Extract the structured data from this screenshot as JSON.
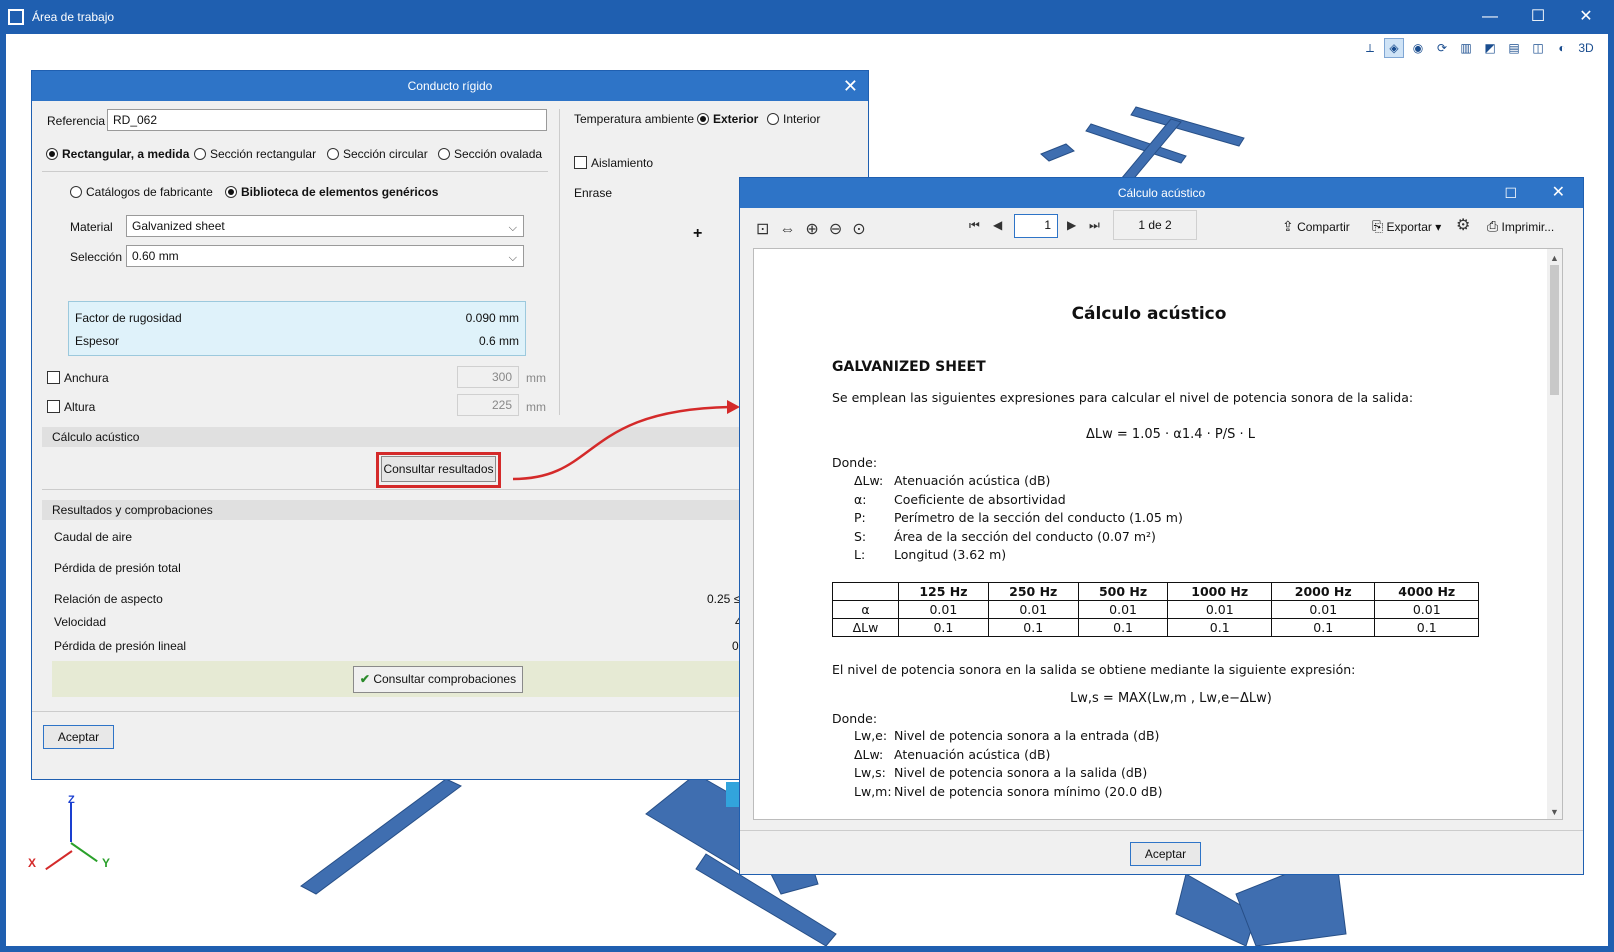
{
  "main_window": {
    "title": "Área de trabajo",
    "minimize": "—",
    "maximize": "☐",
    "close": "✕"
  },
  "view_toolbar": [
    "⟂",
    "◈",
    "◉",
    "⟳",
    "▥",
    "◩",
    "▤",
    "◫",
    "◐",
    "3D"
  ],
  "axes": {
    "x": "X",
    "y": "Y",
    "z": "Z"
  },
  "dialog1": {
    "title": "Conducto rígido",
    "close": "✕",
    "reference_label": "Referencia",
    "reference_value": "RD_062",
    "section_options": [
      "Rectangular, a medida",
      "Sección rectangular",
      "Sección circular",
      "Sección ovalada"
    ],
    "source_options": [
      "Catálogos de fabricante",
      "Biblioteca de elementos genéricos"
    ],
    "material_label": "Material",
    "material_value": "Galvanized sheet",
    "selection_label": "Selección",
    "selection_value": "0.60 mm",
    "info": [
      {
        "label": "Factor de rugosidad",
        "value": "0.090 mm"
      },
      {
        "label": "Espesor",
        "value": "0.6 mm"
      }
    ],
    "width_label": "Anchura",
    "width_value": "300",
    "width_unit": "mm",
    "height_label": "Altura",
    "height_value": "225",
    "height_unit": "mm",
    "temp_label": "Temperatura ambiente",
    "temp_options": [
      "Exterior",
      "Interior"
    ],
    "insulation_label": "Aislamiento",
    "flush_label": "Enrase",
    "acoustic_section": "Cálculo acústico",
    "consult_results": "Consultar resultados",
    "results_section": "Resultados y comprobaciones",
    "results": [
      {
        "label": "Caudal de aire",
        "value": ""
      },
      {
        "label": "Pérdida de presión total",
        "value": ""
      },
      {
        "label": "Relación de aspecto",
        "value": "0.25 ≤"
      },
      {
        "label": "Velocidad",
        "value": "4."
      },
      {
        "label": "Pérdida de presión lineal",
        "value": "0.8"
      }
    ],
    "consult_checks": "Consultar comprobaciones",
    "checkmark": "✔",
    "accept": "Aceptar"
  },
  "dialog2": {
    "title": "Cálculo acústico",
    "maximize": "☐",
    "close": "✕",
    "page_input": "1",
    "page_count": "1 de 2",
    "share": "Compartir",
    "export": "Exportar",
    "print": "Imprimir...",
    "accept": "Aceptar",
    "doc": {
      "title": "Cálculo acústico",
      "material_heading": "GALVANIZED SHEET",
      "intro": "Se emplean las siguientes expresiones para calcular el nivel de potencia sonora de la salida:",
      "formula1": "ΔLw = 1.05 · α1.4 · P/S · L",
      "where": "Donde:",
      "defs1": [
        {
          "sym": "ΔLw:",
          "desc": "Atenuación acústica (dB)"
        },
        {
          "sym": "α:",
          "desc": "Coeficiente de absortividad"
        },
        {
          "sym": "P:",
          "desc": "Perímetro de la sección del conducto (1.05 m)"
        },
        {
          "sym": "S:",
          "desc": "Área de la sección del conducto (0.07 m²)"
        },
        {
          "sym": "L:",
          "desc": "Longitud (3.62 m)"
        }
      ],
      "table_headers": [
        "",
        "125 Hz",
        "250 Hz",
        "500 Hz",
        "1000 Hz",
        "2000 Hz",
        "4000 Hz"
      ],
      "table_rows": [
        [
          "α",
          "0.01",
          "0.01",
          "0.01",
          "0.01",
          "0.01",
          "0.01"
        ],
        [
          "ΔLw",
          "0.1",
          "0.1",
          "0.1",
          "0.1",
          "0.1",
          "0.1"
        ]
      ],
      "intro2": "El nivel de potencia sonora en la salida se obtiene mediante la siguiente expresión:",
      "formula2": "Lw,s = MAX(Lw,m , Lw,e−ΔLw)",
      "defs2": [
        {
          "sym": "Lw,e:",
          "desc": "Nivel de potencia sonora a la entrada (dB)"
        },
        {
          "sym": "ΔLw:",
          "desc": "Atenuación acústica (dB)"
        },
        {
          "sym": "Lw,s:",
          "desc": "Nivel de potencia sonora a la salida (dB)"
        },
        {
          "sym": "Lw,m:",
          "desc": "Nivel de potencia sonora mínimo (20.0 dB)"
        }
      ]
    }
  },
  "colors": {
    "titlebar": "#2e74c7",
    "accent_red": "#d42a2a",
    "duct_blue": "#3f6eb0",
    "info_bg": "#dff2fa"
  }
}
